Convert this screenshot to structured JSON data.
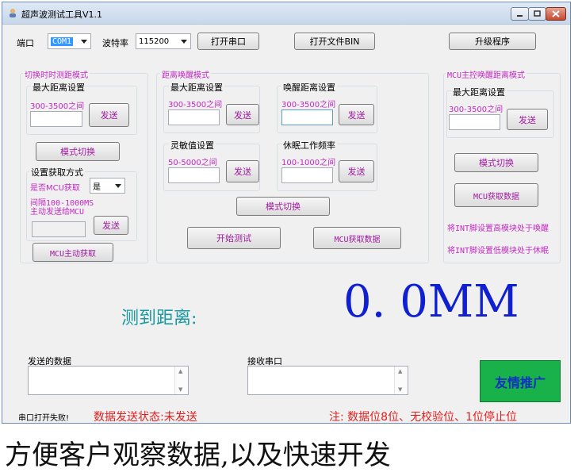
{
  "window": {
    "title": "超声波测试工具V1.1"
  },
  "toolbar": {
    "port_label": "端口",
    "port_value": "COM1",
    "baud_label": "波特率",
    "baud_value": "115200",
    "open_port_label": "打开串口",
    "open_file_label": "打开文件BIN",
    "upgrade_label": "升级程序"
  },
  "left_group": {
    "title": "切换时时测距模式",
    "max_dist_label": "最大距离设置",
    "range_hint": "300-3500之间",
    "send_label": "发送",
    "mode_switch_label": "模式切换",
    "acquire_title": "设置获取方式",
    "mcu_acquire_label": "是否MCU获取",
    "mcu_acquire_value": "是",
    "interval_hint_1": "间隔100-1000MS",
    "interval_hint_2": "主动发送给MCU",
    "send2_label": "发送",
    "mcu_active_label": "MCU主动获取"
  },
  "mid_group": {
    "title": "距离唤醒模式",
    "max_dist_label": "最大距离设置",
    "max_range_hint": "300-3500之间",
    "wake_dist_label": "唤醒距离设置",
    "wake_range_hint": "300-3500之间",
    "sens_label": "灵敏值设置",
    "sens_hint": "50-5000之间",
    "sleep_label": "休眠工作频率",
    "sleep_hint": "100-1000之间",
    "send_label": "发送",
    "mode_switch_label": "模式切换",
    "start_test_label": "开始测试",
    "mcu_get_label": "MCU获取数据"
  },
  "right_group": {
    "title": "MCU主控唤醒距离模式",
    "max_dist_label": "最大距离设置",
    "range_hint": "300-3500之间",
    "send_label": "发送",
    "mode_switch_label": "模式切换",
    "mcu_get_label": "MCU获取数据",
    "int_high_label": "将INT脚设置高模块处于唤醒",
    "int_low_label": "将INT脚设置低模块处于休眠"
  },
  "measure": {
    "label": "测到距离:",
    "value": "0. 0MM"
  },
  "bottom": {
    "sent_label": "发送的数据",
    "recv_label": "接收串口",
    "promo_label": "友情推广",
    "port_status": "串口打开失败!",
    "send_status": "数据发送状态:未发送",
    "note": "注: 数据位8位、无校验位、1位停止位"
  },
  "caption": "方便客户观察数据,以及快速开发",
  "colors": {
    "accent_blue": "#1020d0",
    "teal": "#1a9aa0",
    "magenta": "#c22ac2",
    "red": "#e02020",
    "promo_green": "#19b24a"
  }
}
